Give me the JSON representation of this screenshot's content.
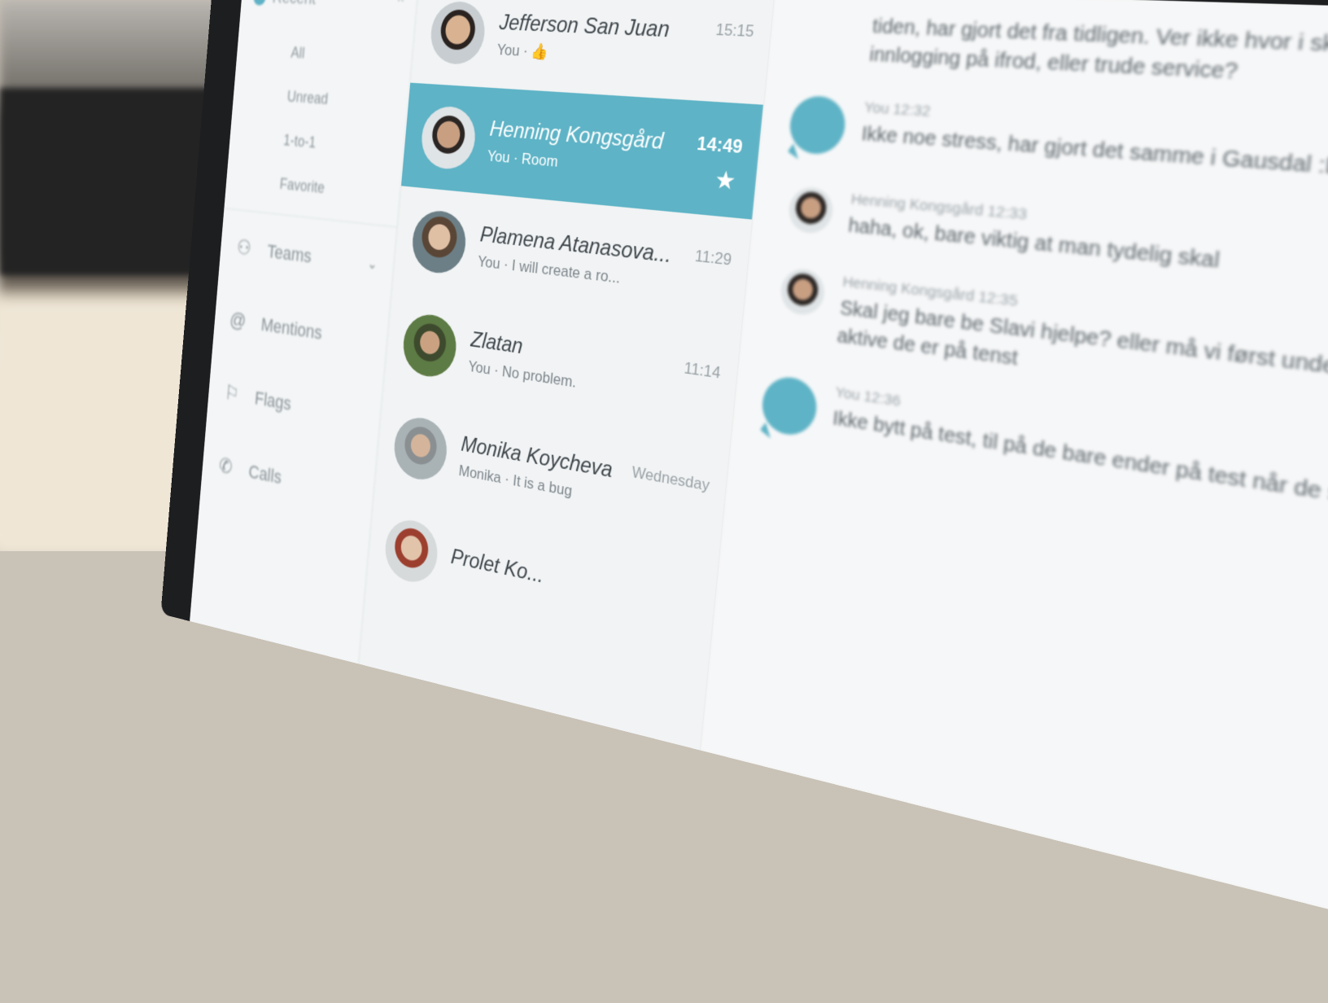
{
  "nav": {
    "recent_label": "Recent",
    "filters": [
      "All",
      "Unread",
      "1-to-1",
      "Favorite"
    ],
    "items": [
      {
        "label": "Teams",
        "icon": "teams-icon",
        "glyph": "⚇"
      },
      {
        "label": "Mentions",
        "icon": "at-icon",
        "glyph": "@"
      },
      {
        "label": "Flags",
        "icon": "flag-icon",
        "glyph": "⚐"
      },
      {
        "label": "Calls",
        "icon": "phone-icon",
        "glyph": "✆"
      }
    ]
  },
  "chats": [
    {
      "name": "Jefferson San Juan",
      "preview": "You · 👍",
      "time": "15:15",
      "avatar": "av1"
    },
    {
      "name": "Henning Kongsgård",
      "preview": "You · Room",
      "time": "14:49",
      "selected": true,
      "starred": true,
      "avatar": "av2"
    },
    {
      "name": "Plamena Atanasova...",
      "preview": "You · I will create a ro...",
      "time": "11:29",
      "avatar": "av3"
    },
    {
      "name": "Zlatan",
      "preview": "You · No problem.",
      "time": "11:14",
      "avatar": "av4"
    },
    {
      "name": "Monika Koycheva",
      "preview": "Monika · It is a bug",
      "time": "Wednesday",
      "avatar": "av5"
    },
    {
      "name": "Prolet Ko...",
      "preview": "",
      "time": "",
      "avatar": "av6"
    }
  ],
  "conversation": {
    "top_text": "tiden, har gjort det fra tidligen. Ver ikke hvor i skjeen de er, men si ingen innlogging på ifrod, eller trude service?",
    "messages": [
      {
        "type": "self",
        "meta": "You 12:32",
        "body": "Ikke noe stress, har gjort det samme i Gausdal :D"
      },
      {
        "type": "other",
        "meta": "Henning Kongsgård 12:33",
        "body": "haha, ok, bare viktig at man tydelig skal"
      },
      {
        "type": "other",
        "meta": "Henning Kongsgård 12:35",
        "body": "Skal jeg bare be Slavi hjelpe? eller må vi først undersøke? aner ikke hvor aktive de er på tenst"
      },
      {
        "type": "self",
        "meta": "You 12:36",
        "body": "Ikke bytt på test, til på de bare ender på test når de skal ..."
      }
    ]
  },
  "colors": {
    "accent": "#5eb3c6",
    "bezel": "#1d1e20"
  }
}
